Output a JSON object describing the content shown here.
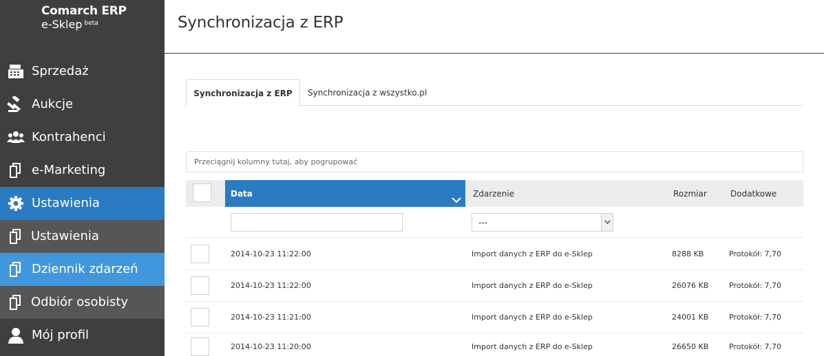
{
  "brand": {
    "line1": "Comarch ERP",
    "line2": "e-Sklep",
    "badge": "beta"
  },
  "sidebar": {
    "items": [
      {
        "label": "Sprzedaż",
        "icon": "cash-register-icon"
      },
      {
        "label": "Aukcje",
        "icon": "gavel-icon"
      },
      {
        "label": "Kontrahenci",
        "icon": "users-icon"
      },
      {
        "label": "e-Marketing",
        "icon": "copy-icon"
      },
      {
        "label": "Ustawienia",
        "icon": "gear-icon",
        "state": "active"
      },
      {
        "label": "Ustawienia",
        "icon": "copy-icon",
        "state": "sub"
      },
      {
        "label": "Dziennik zdarzeń",
        "icon": "copy-icon",
        "state": "sub-selected"
      },
      {
        "label": "Odbiór osobisty",
        "icon": "copy-icon",
        "state": "sub"
      },
      {
        "label": "Mój profil",
        "icon": "user-icon"
      }
    ]
  },
  "page": {
    "title": "Synchronizacja z ERP"
  },
  "tabs": [
    {
      "label": "Synchronizacja z ERP",
      "active": true
    },
    {
      "label": "Synchronizacja z wszystko.pl",
      "active": false
    }
  ],
  "grid": {
    "group_hint": "Przeciągnij kolumny tutaj, aby pogrupować",
    "columns": {
      "data": "Data",
      "event": "Zdarzenie",
      "size": "Rozmiar",
      "extra": "Dodatkowe"
    },
    "filter": {
      "date_value": "",
      "event_selected": "---"
    },
    "rows": [
      {
        "date": "2014-10-23 11:22:00",
        "event": "Import danych z ERP do e-Sklep",
        "size": "8288 KB",
        "extra": "Protokół: 7,70"
      },
      {
        "date": "2014-10-23 11:22:00",
        "event": "Import danych z ERP do e-Sklep",
        "size": "26076 KB",
        "extra": "Protokół: 7,70"
      },
      {
        "date": "2014-10-23 11:21:00",
        "event": "Import danych z ERP do e-Sklep",
        "size": "24001 KB",
        "extra": "Protokół: 7,70"
      },
      {
        "date": "2014-10-23 11:20:00",
        "event": "Import danych z ERP do e-Sklep",
        "size": "26650 KB",
        "extra": "Protokół: 7,70"
      }
    ]
  },
  "colors": {
    "sidebar_bg": "#3f3f3f",
    "active_blue": "#2a7bc2",
    "sub_bg": "#565656",
    "selected_sub": "#4097dd"
  }
}
